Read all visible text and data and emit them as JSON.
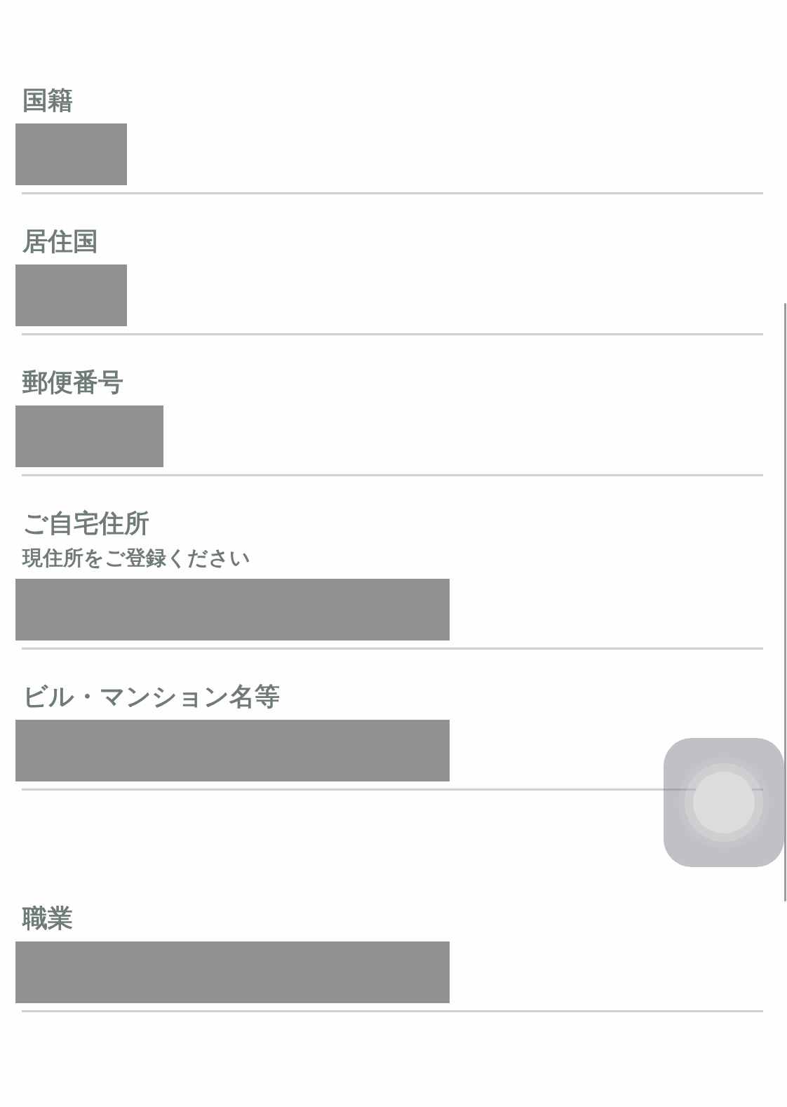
{
  "sections": [
    {
      "fields": [
        {
          "label": "国籍",
          "kind": "short"
        },
        {
          "label": "居住国",
          "kind": "short"
        },
        {
          "label": "郵便番号",
          "kind": "medium"
        },
        {
          "label": "ご自宅住所",
          "note": "現住所をご登録ください",
          "kind": "long"
        },
        {
          "label": "ビル・マンション名等",
          "kind": "long"
        }
      ]
    },
    {
      "fields": [
        {
          "label": "職業",
          "kind": "long"
        }
      ]
    }
  ]
}
